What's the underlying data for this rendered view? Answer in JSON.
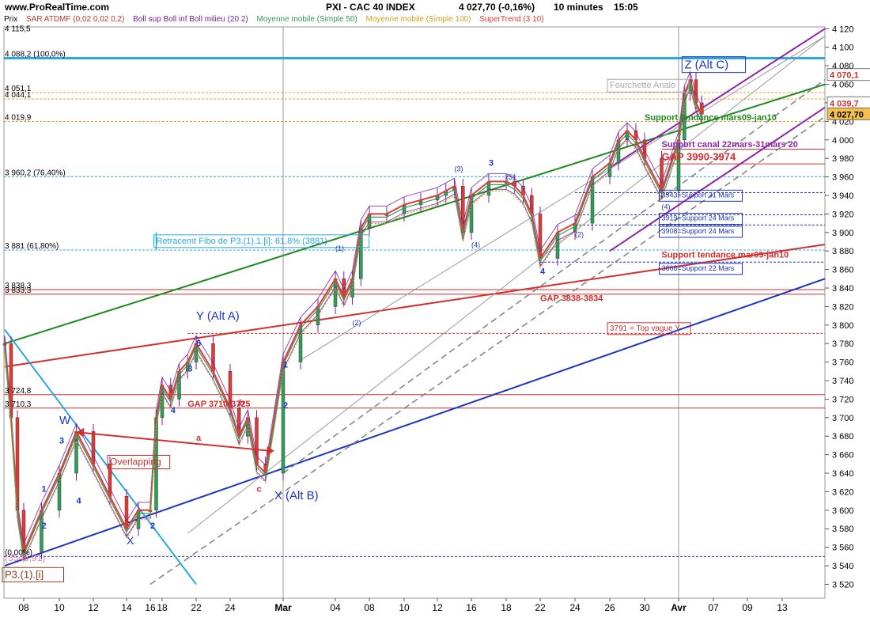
{
  "header": {
    "site": "www.ProRealTime.com",
    "instrument": "PXI - CAC 40 INDEX",
    "price": "4 027,70 (-0,16%)",
    "interval": "10 minutes",
    "time": "15:05"
  },
  "indicators": {
    "prix": "Prix",
    "sar": "SAR ATDMF (0,02 0,02 0,2)",
    "boll": "Boll sup Boll inf Boll milieu (20 2)",
    "mm50": "Moyenne mobile (Simple 50)",
    "mm100": "Moyenne mobile (Simple 100)",
    "supertrend": "SuperTrend (3 10)"
  },
  "colors": {
    "sar": "#c0392b",
    "boll": "#7b1fa2",
    "mm50": "#2e9e5b",
    "mm100": "#d4a017",
    "supertrend": "#e53935",
    "line_cyan": "#2aa9e0",
    "green_trend": "#1f8a1f",
    "red_trend": "#d32f2f",
    "blue_trend": "#1d35c4",
    "purple_chan": "#8e24aa"
  },
  "chart_data": {
    "type": "line",
    "title": "PXI - CAC 40 INDEX",
    "interval": "10 minutes",
    "ylim": [
      3505,
      4122
    ],
    "yticks": [
      3520,
      3540,
      3560,
      3580,
      3600,
      3620,
      3640,
      3660,
      3680,
      3700,
      3720,
      3740,
      3760,
      3780,
      3800,
      3820,
      3840,
      3860,
      3880,
      3900,
      3920,
      3940,
      3960,
      3980,
      4000,
      4020,
      4040,
      4060,
      4080,
      4100,
      4120
    ],
    "xticks": [
      "08",
      "10",
      "12",
      "14",
      "16",
      "18",
      "22",
      "24",
      "Mar",
      "04",
      "08",
      "10",
      "12",
      "16",
      "18",
      "22",
      "24",
      "26",
      "30",
      "Avr",
      "07",
      "09",
      "13"
    ],
    "price_series": [
      {
        "date": "feb05",
        "value": 3780
      },
      {
        "date": "feb06",
        "value": 3700
      },
      {
        "date": "feb07",
        "value": 3600
      },
      {
        "date": "feb08",
        "value": 3555
      },
      {
        "date": "feb09",
        "value": 3600
      },
      {
        "date": "feb10",
        "value": 3640
      },
      {
        "date": "feb11",
        "value": 3685
      },
      {
        "date": "feb12",
        "value": 3650
      },
      {
        "date": "feb13",
        "value": 3615
      },
      {
        "date": "feb14",
        "value": 3580
      },
      {
        "date": "feb15",
        "value": 3600
      },
      {
        "date": "feb16",
        "value": 3600
      },
      {
        "date": "feb17",
        "value": 3700
      },
      {
        "date": "feb18",
        "value": 3735
      },
      {
        "date": "feb19",
        "value": 3720
      },
      {
        "date": "feb20",
        "value": 3750
      },
      {
        "date": "feb21",
        "value": 3760
      },
      {
        "date": "feb22",
        "value": 3780
      },
      {
        "date": "feb23",
        "value": 3750
      },
      {
        "date": "feb24",
        "value": 3710
      },
      {
        "date": "feb25",
        "value": 3680
      },
      {
        "date": "feb26",
        "value": 3700
      },
      {
        "date": "feb27",
        "value": 3650
      },
      {
        "date": "feb28",
        "value": 3640
      },
      {
        "date": "mar01",
        "value": 3760
      },
      {
        "date": "mar02",
        "value": 3800
      },
      {
        "date": "mar03",
        "value": 3820
      },
      {
        "date": "mar04",
        "value": 3850
      },
      {
        "date": "mar05",
        "value": 3830
      },
      {
        "date": "mar06",
        "value": 3850
      },
      {
        "date": "mar07",
        "value": 3905
      },
      {
        "date": "mar08",
        "value": 3920
      },
      {
        "date": "mar09",
        "value": 3920
      },
      {
        "date": "mar10",
        "value": 3930
      },
      {
        "date": "mar11",
        "value": 3935
      },
      {
        "date": "mar12",
        "value": 3940
      },
      {
        "date": "mar13",
        "value": 3945
      },
      {
        "date": "mar14",
        "value": 3950
      },
      {
        "date": "mar15",
        "value": 3900
      },
      {
        "date": "mar16",
        "value": 3940
      },
      {
        "date": "mar17",
        "value": 3955
      },
      {
        "date": "mar18",
        "value": 3955
      },
      {
        "date": "mar19",
        "value": 3950
      },
      {
        "date": "mar20",
        "value": 3940
      },
      {
        "date": "mar21",
        "value": 3920
      },
      {
        "date": "mar22",
        "value": 3872
      },
      {
        "date": "mar23",
        "value": 3900
      },
      {
        "date": "mar24",
        "value": 3910
      },
      {
        "date": "mar25",
        "value": 3960
      },
      {
        "date": "mar26",
        "value": 3975
      },
      {
        "date": "mar27",
        "value": 4000
      },
      {
        "date": "mar28",
        "value": 4010
      },
      {
        "date": "mar29",
        "value": 4000
      },
      {
        "date": "mar30",
        "value": 3980
      },
      {
        "date": "mar31",
        "value": 3945
      },
      {
        "date": "apr01",
        "value": 4000
      },
      {
        "date": "apr02",
        "value": 4050
      },
      {
        "date": "apr03",
        "value": 4065
      },
      {
        "date": "apr04",
        "value": 4040
      },
      {
        "date": "apr05",
        "value": 4027.7
      }
    ],
    "right_axis_labels": [
      {
        "text": "4 070,1",
        "value": 4070.1
      },
      {
        "text": "4 039,7",
        "value": 4039.7
      },
      {
        "text": "4 027,70",
        "value": 4027.7
      }
    ],
    "left_axis_labels": [
      {
        "text": "4 115,5",
        "value": 4115.5
      },
      {
        "text": "4 088,2 (100,0%)",
        "value": 4088.2
      },
      {
        "text": "4 051,1",
        "value": 4051.1
      },
      {
        "text": "4 044,1",
        "value": 4044.1
      },
      {
        "text": "4 019,9",
        "value": 4019.9
      },
      {
        "text": "3 960,2 (76,40%)",
        "value": 3960.2
      },
      {
        "text": "3 881 (61,80%)",
        "value": 3881
      },
      {
        "text": "3 838,3",
        "value": 3838.3
      },
      {
        "text": "3 833,3",
        "value": 3833.3
      },
      {
        "text": "3 724,8",
        "value": 3724.8
      },
      {
        "text": "3 710,3",
        "value": 3710.3
      },
      {
        "text": "(0,00%)",
        "value": 3550
      }
    ],
    "hlines": [
      {
        "value": 4088.2,
        "color": "#2aa9e0",
        "width": 3,
        "dash": ""
      },
      {
        "value": 4051.1,
        "color": "#e6a020",
        "width": 1,
        "dash": "3,2"
      },
      {
        "value": 4044.1,
        "color": "#e6a020",
        "width": 1,
        "dash": "3,2"
      },
      {
        "value": 4019.9,
        "color": "#e6a020",
        "width": 1,
        "dash": "3,2"
      },
      {
        "value": 3960.2,
        "color": "#2aa9e0",
        "width": 1,
        "dash": "3,2"
      },
      {
        "value": 3881,
        "color": "#2aa9e0",
        "width": 1,
        "dash": "3,2"
      },
      {
        "value": 3838.3,
        "color": "#d32f2f",
        "width": 1,
        "dash": ""
      },
      {
        "value": 3833.3,
        "color": "#d32f2f",
        "width": 1,
        "dash": ""
      },
      {
        "value": 3724.8,
        "color": "#d32f2f",
        "width": 1,
        "dash": ""
      },
      {
        "value": 3710.3,
        "color": "#d32f2f",
        "width": 1,
        "dash": ""
      },
      {
        "value": 3550,
        "color": "#1d35c4",
        "width": 1,
        "dash": "3,2"
      },
      {
        "value": 3791,
        "color": "#d32f2f",
        "width": 1,
        "dash": "3,2",
        "from": "feb21"
      },
      {
        "value": 3943,
        "color": "#1d35c4",
        "width": 1,
        "dash": "3,2",
        "from": "mar24"
      },
      {
        "value": 3919,
        "color": "#1d35c4",
        "width": 1,
        "dash": "3,2",
        "from": "mar24"
      },
      {
        "value": 3908,
        "color": "#1d35c4",
        "width": 1,
        "dash": "3,2",
        "from": "mar24"
      },
      {
        "value": 3868,
        "color": "#1d35c4",
        "width": 1,
        "dash": "3,2",
        "from": "mar22"
      },
      {
        "value": 3990,
        "color": "#d32f2f",
        "width": 1,
        "dash": "",
        "from": "mar31"
      },
      {
        "value": 3974,
        "color": "#d32f2f",
        "width": 1,
        "dash": "",
        "from": "mar31"
      }
    ],
    "trendlines": [
      {
        "name": "green_support",
        "color": "#1f8a1f",
        "width": 2,
        "dash": "",
        "p1": [
          "feb05",
          3780
        ],
        "p2": [
          "apr14",
          4060
        ]
      },
      {
        "name": "red_support",
        "color": "#d32f2f",
        "width": 2,
        "dash": "",
        "p1": [
          "feb05",
          3755
        ],
        "p2": [
          "apr14",
          3887
        ]
      },
      {
        "name": "blue_support",
        "color": "#1d35c4",
        "width": 2,
        "dash": "",
        "p1": [
          "feb05",
          3540
        ],
        "p2": [
          "apr14",
          3850
        ]
      },
      {
        "name": "cyan_down",
        "color": "#2aa9e0",
        "width": 2,
        "dash": "",
        "p1": [
          "feb05",
          3795
        ],
        "p2": [
          "feb22",
          3520
        ]
      },
      {
        "name": "purple_upper",
        "color": "#8e24aa",
        "width": 2,
        "dash": "",
        "p1": [
          "mar26",
          3970
        ],
        "p2": [
          "apr14",
          4120
        ]
      },
      {
        "name": "purple_lower",
        "color": "#8e24aa",
        "width": 2,
        "dash": "",
        "p1": [
          "mar26",
          3880
        ],
        "p2": [
          "apr14",
          4035
        ]
      },
      {
        "name": "grey_dash_1",
        "color": "#808080",
        "width": 1.5,
        "dash": "8,5",
        "p1": [
          "feb16",
          3520
        ],
        "p2": [
          "apr14",
          4025
        ]
      },
      {
        "name": "grey_dash_2",
        "color": "#808080",
        "width": 1.5,
        "dash": "8,5",
        "p1": [
          "mar01",
          3640
        ],
        "p2": [
          "apr14",
          4065
        ]
      },
      {
        "name": "grey_thin_1",
        "color": "#9a9a9a",
        "width": 1,
        "dash": "",
        "p1": [
          "feb21",
          3575
        ],
        "p2": [
          "apr14",
          4112
        ]
      },
      {
        "name": "grey_thin_2",
        "color": "#9a9a9a",
        "width": 1,
        "dash": "",
        "p1": [
          "mar02",
          3762
        ],
        "p2": [
          "apr14",
          4112
        ]
      }
    ],
    "annotations": [
      {
        "text": "Y (Alt A)",
        "date": "feb22",
        "value": 3806,
        "color": "#1d35c4",
        "size": 15,
        "bold": false
      },
      {
        "text": "X (Alt B)",
        "date": "feb29",
        "value": 3612,
        "color": "#1d35c4",
        "size": 15,
        "bold": false
      },
      {
        "text": "W",
        "date": "feb10",
        "value": 3693,
        "color": "#1d35c4",
        "size": 15,
        "bold": false
      },
      {
        "text": "X",
        "date": "feb14",
        "value": 3563,
        "color": "#1d35c4",
        "size": 14,
        "bold": false
      },
      {
        "text": "Retracemt Fibo de P3.(1).1.[i]: 61,8% (3881)",
        "date": "feb17",
        "value": 3888,
        "color": "#2aa9e0",
        "size": 11,
        "bold": false,
        "box": true
      },
      {
        "text": "Overlapping",
        "date": "feb13",
        "value": 3649,
        "color": "#d32f2f",
        "size": 12,
        "bold": false,
        "box": true
      },
      {
        "text": "GAP 3838-3834",
        "date": "mar22",
        "value": 3826,
        "color": "#d32f2f",
        "size": 11,
        "bold": true
      },
      {
        "text": "GAP 3710-3725",
        "date": "feb21",
        "value": 3712,
        "color": "#d32f2f",
        "size": 11,
        "bold": true
      },
      {
        "text": "3791 = Top vague Y",
        "date": "mar26",
        "value": 3794,
        "color": "#d32f2f",
        "size": 10,
        "bold": false,
        "box": true
      },
      {
        "text": "GAP 3990-3974",
        "date": "mar31",
        "value": 3978,
        "color": "#d32f2f",
        "size": 13,
        "bold": true
      },
      {
        "text": "Support canal 22mars-31mars 20",
        "date": "mar31",
        "value": 3992,
        "color": "#8e24aa",
        "size": 11,
        "bold": true
      },
      {
        "text": "Support tendance mars09-jan10",
        "date": "mar30",
        "value": 4021,
        "color": "#1f8a1f",
        "size": 11,
        "bold": true
      },
      {
        "text": "Fourchette Analo",
        "date": "mar26",
        "value": 4056,
        "color": "#aaaaaa",
        "size": 11,
        "bold": false,
        "box": true
      },
      {
        "text": "3943=Support 31 Mars",
        "date": "mar31",
        "value": 3938,
        "color": "#1d35c4",
        "size": 9,
        "bold": false,
        "box": true
      },
      {
        "text": "3919=Support 24 Mars",
        "date": "mar31",
        "value": 3913,
        "color": "#1d35c4",
        "size": 9,
        "bold": false,
        "box": true
      },
      {
        "text": "3908=Support 24 Mars",
        "date": "mar31",
        "value": 3899,
        "color": "#1d35c4",
        "size": 9,
        "bold": false,
        "box": true
      },
      {
        "text": "3868=Support 22 Mars",
        "date": "mar31",
        "value": 3859,
        "color": "#1d35c4",
        "size": 9,
        "bold": false,
        "box": true
      },
      {
        "text": "Support tendance mar09-jan10",
        "date": "mar31",
        "value": 3873,
        "color": "#d32f2f",
        "size": 11,
        "bold": true
      },
      {
        "text": "P3.(1).[i]",
        "date": "feb05",
        "value": 3527,
        "color": "#8b3a1a",
        "size": 13,
        "bold": false,
        "box": true
      },
      {
        "text": "Z (Alt C)",
        "date": "apr02",
        "value": 4077,
        "color": "#1d35c4",
        "size": 15,
        "bold": false,
        "box": true
      },
      {
        "text": "(3545,91)",
        "date": "feb05",
        "value": 3545,
        "color": "#e87fb4",
        "size": 12,
        "bold": false
      },
      {
        "text": "(1)",
        "date": "mar04",
        "value": 3880,
        "color": "#1d35c4",
        "size": 9,
        "bold": false
      },
      {
        "text": "(2)",
        "date": "mar06",
        "value": 3800,
        "color": "#1d35c4",
        "size": 9,
        "bold": false
      },
      {
        "text": "(3)",
        "date": "mar14",
        "value": 3966,
        "color": "#1d35c4",
        "size": 9,
        "bold": false
      },
      {
        "text": "(4)",
        "date": "mar16",
        "value": 3884,
        "color": "#1d35c4",
        "size": 9,
        "bold": false
      },
      {
        "text": "(5)",
        "date": "mar18",
        "value": 3957,
        "color": "#1d35c4",
        "size": 9,
        "bold": false
      },
      {
        "text": "3",
        "date": "mar17",
        "value": 3972,
        "color": "#1d35c4",
        "size": 11,
        "bold": true
      },
      {
        "text": "4",
        "date": "mar22",
        "value": 3855,
        "color": "#1d35c4",
        "size": 11,
        "bold": true
      },
      {
        "text": "(2)",
        "date": "mar24",
        "value": 3895,
        "color": "#1d35c4",
        "size": 9,
        "bold": false
      },
      {
        "text": "(4)",
        "date": "mar31",
        "value": 3925,
        "color": "#1d35c4",
        "size": 9,
        "bold": false
      },
      {
        "text": "a",
        "date": "feb22",
        "value": 3675,
        "color": "#d32f2f",
        "size": 11,
        "bold": true
      },
      {
        "text": "b",
        "date": "feb25",
        "value": 3713,
        "color": "#d32f2f",
        "size": 11,
        "bold": true
      },
      {
        "text": "c",
        "date": "feb27",
        "value": 3620,
        "color": "#d32f2f",
        "size": 11,
        "bold": true
      },
      {
        "text": "1",
        "date": "feb09",
        "value": 3620,
        "color": "#1d35c4",
        "size": 11,
        "bold": true
      },
      {
        "text": "2",
        "date": "feb09",
        "value": 3580,
        "color": "#1d35c4",
        "size": 11,
        "bold": true
      },
      {
        "text": "3",
        "date": "feb10",
        "value": 3672,
        "color": "#1d35c4",
        "size": 11,
        "bold": true
      },
      {
        "text": "4",
        "date": "feb11",
        "value": 3607,
        "color": "#1d35c4",
        "size": 11,
        "bold": true
      },
      {
        "text": "2",
        "date": "feb16",
        "value": 3580,
        "color": "#1d35c4",
        "size": 11,
        "bold": true
      },
      {
        "text": "3",
        "date": "feb21",
        "value": 3750,
        "color": "#1d35c4",
        "size": 11,
        "bold": true
      },
      {
        "text": "4",
        "date": "feb19",
        "value": 3705,
        "color": "#1d35c4",
        "size": 11,
        "bold": true
      },
      {
        "text": "5",
        "date": "feb22",
        "value": 3777,
        "color": "#1d35c4",
        "size": 11,
        "bold": true
      },
      {
        "text": "1",
        "date": "mar01",
        "value": 3754,
        "color": "#1d35c4",
        "size": 11,
        "bold": true
      },
      {
        "text": "2",
        "date": "mar01",
        "value": 3710,
        "color": "#1d35c4",
        "size": 11,
        "bold": true
      }
    ]
  }
}
